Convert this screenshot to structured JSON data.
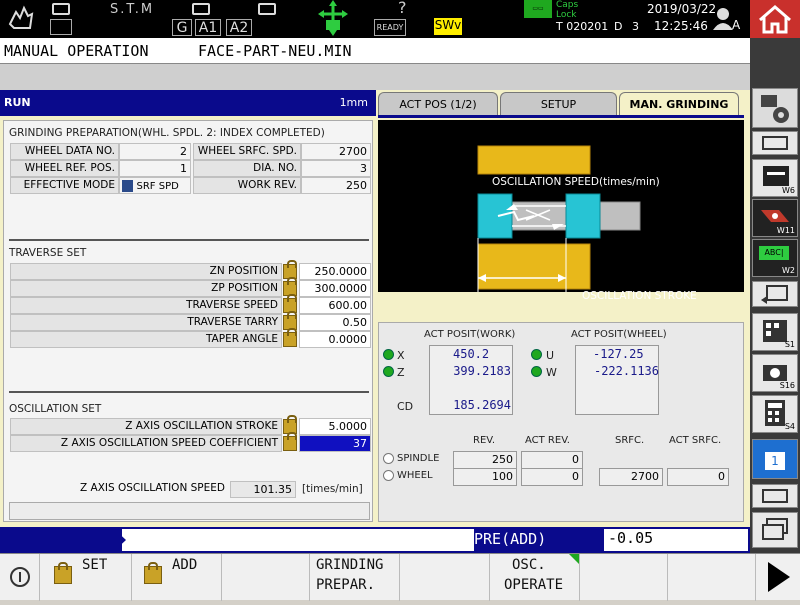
{
  "status": {
    "stm": "S.T.M",
    "g": "G",
    "a1": "A1",
    "a2": "A2",
    "ready": "READY",
    "swv": "SWv",
    "caps": "Caps\nLock",
    "capslock_label": "Caps Lock",
    "date": "2019/03/22",
    "time": "12:25:46",
    "tool_t": "T 020201",
    "d": "D",
    "d_val": "3",
    "user_letter": "A",
    "question": "?"
  },
  "header": {
    "mode": "MANUAL OPERATION",
    "program": "FACE-PART-NEU.MIN"
  },
  "runbar": {
    "run": "RUN",
    "unit": "1mm"
  },
  "tabs": [
    {
      "label": "ACT POS (1/2)"
    },
    {
      "label": "SETUP"
    },
    {
      "label": "MAN. GRINDING"
    }
  ],
  "grinding_prep": {
    "title": "GRINDING PREPARATION(WHL. SPDL. 2: INDEX COMPLETED)",
    "wheel_data_no_label": "WHEEL DATA NO.",
    "wheel_data_no": "2",
    "wheel_srfc_spd_label": "WHEEL SRFC. SPD.",
    "wheel_srfc_spd": "2700",
    "wheel_ref_pos_label": "WHEEL REF. POS.",
    "wheel_ref_pos": "1",
    "dia_no_label": "DIA. NO.",
    "dia_no": "3",
    "effective_mode_label": "EFFECTIVE MODE",
    "effective_mode": "SRF SPD",
    "work_rev_label": "WORK REV.",
    "work_rev": "250"
  },
  "traverse": {
    "title": "TRAVERSE SET",
    "rows": [
      {
        "label": "ZN POSITION",
        "value": "250.0000"
      },
      {
        "label": "ZP POSITION",
        "value": "300.0000"
      },
      {
        "label": "TRAVERSE SPEED",
        "value": "600.00"
      },
      {
        "label": "TRAVERSE TARRY",
        "value": "0.50"
      },
      {
        "label": "TAPER ANGLE",
        "value": "0.0000"
      }
    ]
  },
  "oscillation": {
    "title": "OSCILLATION SET",
    "stroke_label": "Z AXIS OSCILLATION STROKE",
    "stroke": "5.0000",
    "coef_label": "Z AXIS OSCILLATION SPEED COEFFICIENT",
    "coef": "37",
    "speed_label": "Z AXIS OSCILLATION SPEED",
    "speed": "101.35",
    "speed_unit": "[times/min]"
  },
  "diagram": {
    "speed_label": "OSCILLATION SPEED(times/min)",
    "stroke_label": "OSCILLATION STROKE"
  },
  "act_posit": {
    "work_title": "ACT POSIT(WORK)",
    "wheel_title": "ACT POSIT(WHEEL)",
    "x_label": "X",
    "x": "450.2",
    "z_label": "Z",
    "z": "399.2183",
    "cd_label": "CD",
    "cd": "185.2694",
    "u_label": "U",
    "u": "-127.25",
    "w_label": "W",
    "w": "-222.1136"
  },
  "spindle": {
    "rev_h": "REV.",
    "act_rev_h": "ACT REV.",
    "srfc_h": "SRFC.",
    "act_srfc_h": "ACT SRFC.",
    "spindle_label": "SPINDLE",
    "spindle_rev": "250",
    "spindle_act_rev": "0",
    "wheel_label": "WHEEL",
    "wheel_rev": "100",
    "wheel_act_rev": "0",
    "wheel_srfc": "2700",
    "wheel_act_srfc": "0"
  },
  "inputbar": {
    "mode": "PRE(ADD)",
    "value": "-0.05"
  },
  "sidebar": {
    "w6": "W6",
    "w11": "W11",
    "w2": "W2",
    "abc": "ABC|",
    "s1": "S1",
    "s16": "S16",
    "s4": "S4",
    "page": "1"
  },
  "softkeys": {
    "set": "SET",
    "add": "ADD",
    "grinding_1": "GRINDING",
    "grinding_2": "PREPAR.",
    "osc_1": "OSC.",
    "osc_2": "OPERATE"
  },
  "colors": {
    "accent_blue": "#0a0a8c",
    "highlight_blue": "#1010c0",
    "panel_yellow": "#f4f1c8",
    "home_red": "#c9302c",
    "swv_yellow": "#ffee00",
    "led_green": "#1fa81f"
  }
}
